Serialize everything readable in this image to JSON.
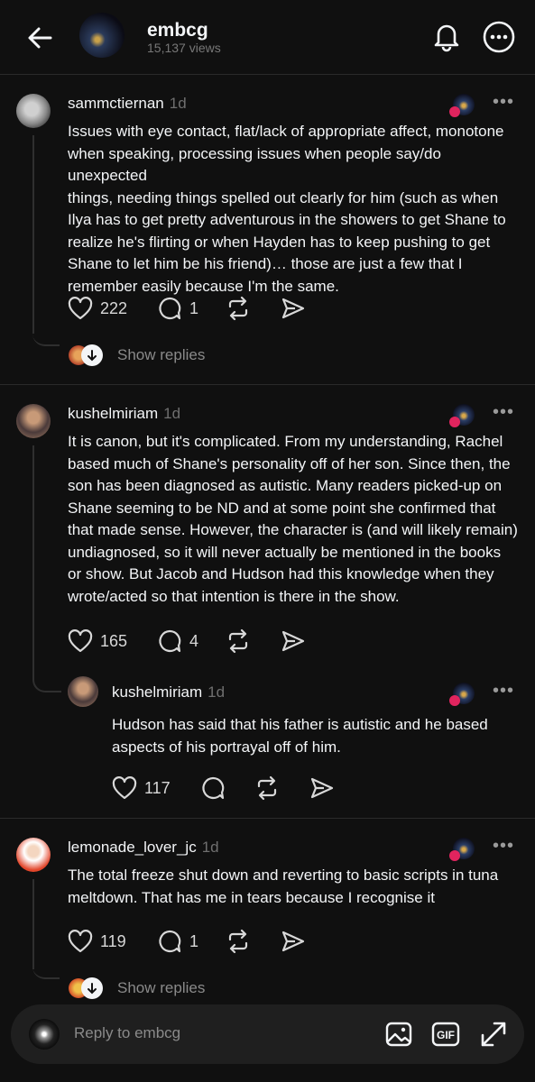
{
  "header": {
    "title": "embcg",
    "views": "15,137 views"
  },
  "comments": [
    {
      "username": "sammctiernan",
      "time": "1d",
      "lines": [
        "Issues with eye contact, flat/lack of appropriate affect, monotone",
        "when speaking, processing issues when people say/do unexpected",
        "things, needing things spelled out clearly for him (such as when",
        "Ilya has to get pretty adventurous in the showers to get Shane to",
        "realize he's flirting or when Hayden has to keep pushing to get",
        "Shane to let him be his friend)… those are just a few that I",
        "remember easily because I'm the same."
      ],
      "likes": "222",
      "replies": "1",
      "show_replies": "Show replies"
    },
    {
      "username": "kushelmiriam",
      "time": "1d",
      "lines": [
        "It is canon, but it's complicated. From my understanding, Rachel",
        "based much of Shane's personality off of her son. Since then, the",
        "son has been diagnosed as autistic. Many readers picked-up on",
        "Shane seeming to be ND and at some point she confirmed that",
        "that made sense. However, the character is (and will likely remain)",
        "undiagnosed, so it will never actually be mentioned in the books",
        "or show. But Jacob and Hudson had this knowledge when they",
        "wrote/acted so that intention is there in the show."
      ],
      "likes": "165",
      "replies": "4"
    },
    {
      "username": "kushelmiriam",
      "time": "1d",
      "lines": [
        "Hudson has said that his father is autistic and he based",
        "aspects of his portrayal off of him."
      ],
      "likes": "117",
      "replies": ""
    },
    {
      "username": "lemonade_lover_jc",
      "time": "1d",
      "lines": [
        "The total freeze shut down and reverting to basic scripts in tuna",
        "meltdown. That has me in tears because I recognise it"
      ],
      "likes": "119",
      "replies": "1",
      "show_replies": "Show replies"
    }
  ],
  "reply_bar": {
    "placeholder": "Reply to embcg"
  },
  "colors": {
    "background": "#101010",
    "text": "#f3f5f7",
    "muted": "#777777",
    "like": "#e0245e"
  }
}
